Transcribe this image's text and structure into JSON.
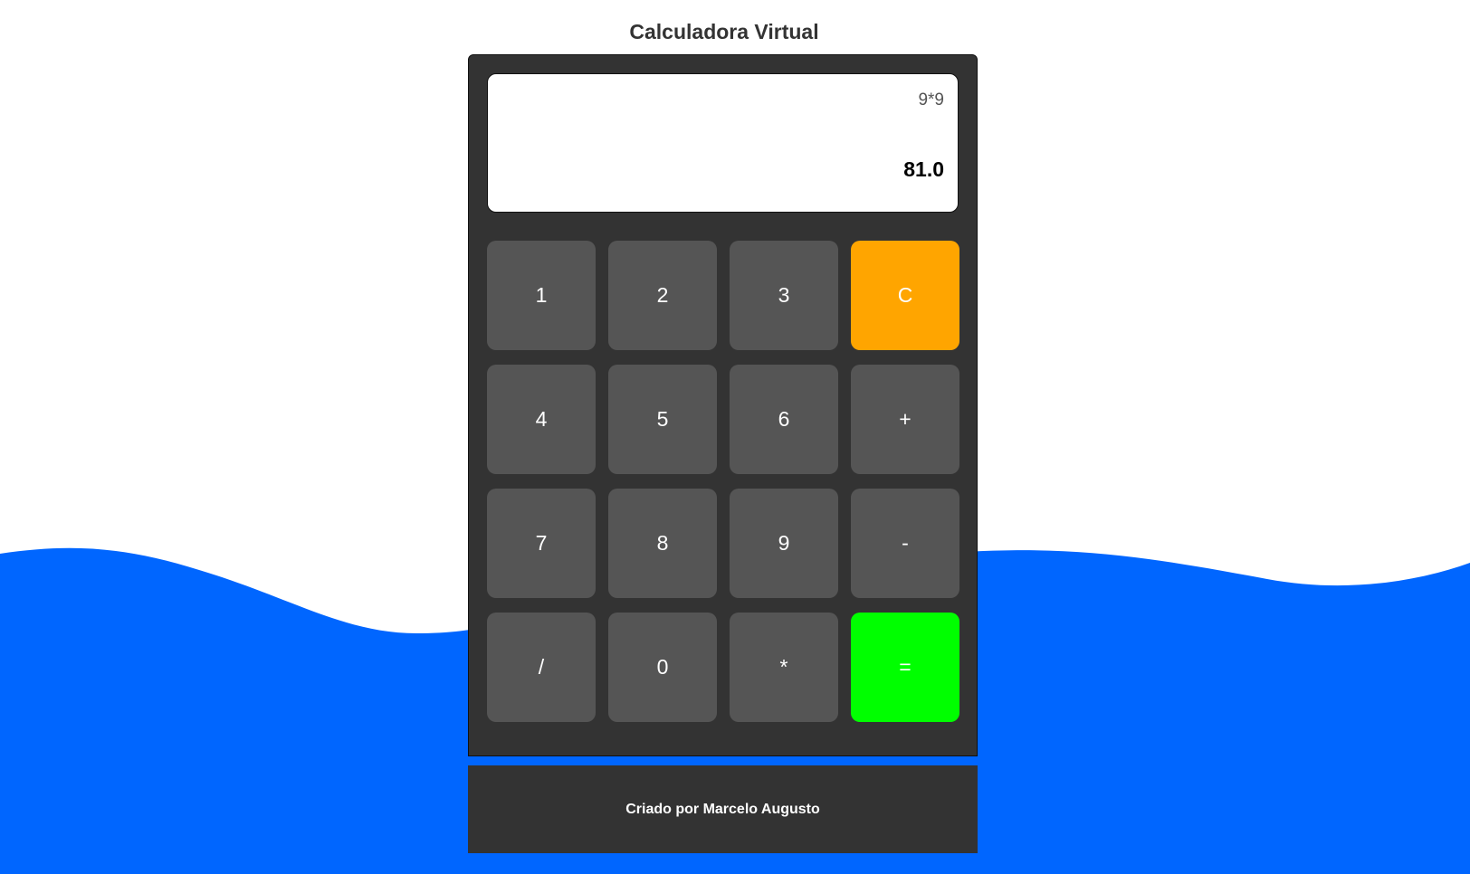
{
  "page": {
    "title": "Calculadora Virtual"
  },
  "display": {
    "expression": "9*9",
    "result": "81.0"
  },
  "keys": [
    {
      "label": "1",
      "name": "key-1"
    },
    {
      "label": "2",
      "name": "key-2"
    },
    {
      "label": "3",
      "name": "key-3"
    },
    {
      "label": "C",
      "name": "clear-button"
    },
    {
      "label": "4",
      "name": "key-4"
    },
    {
      "label": "5",
      "name": "key-5"
    },
    {
      "label": "6",
      "name": "key-6"
    },
    {
      "label": "+",
      "name": "add-button"
    },
    {
      "label": "7",
      "name": "key-7"
    },
    {
      "label": "8",
      "name": "key-8"
    },
    {
      "label": "9",
      "name": "key-9"
    },
    {
      "label": "-",
      "name": "subtract-button"
    },
    {
      "label": "/",
      "name": "divide-button"
    },
    {
      "label": "0",
      "name": "key-0"
    },
    {
      "label": "*",
      "name": "multiply-button"
    },
    {
      "label": "=",
      "name": "equals-button"
    }
  ],
  "footer": {
    "text": "Criado por Marcelo Augusto"
  },
  "colors": {
    "background": "#ffffff",
    "wave": "#0066ff",
    "calculator_body": "#333333",
    "key": "#555555",
    "clear_key": "#ffa500",
    "equals_key": "#00ff00"
  }
}
